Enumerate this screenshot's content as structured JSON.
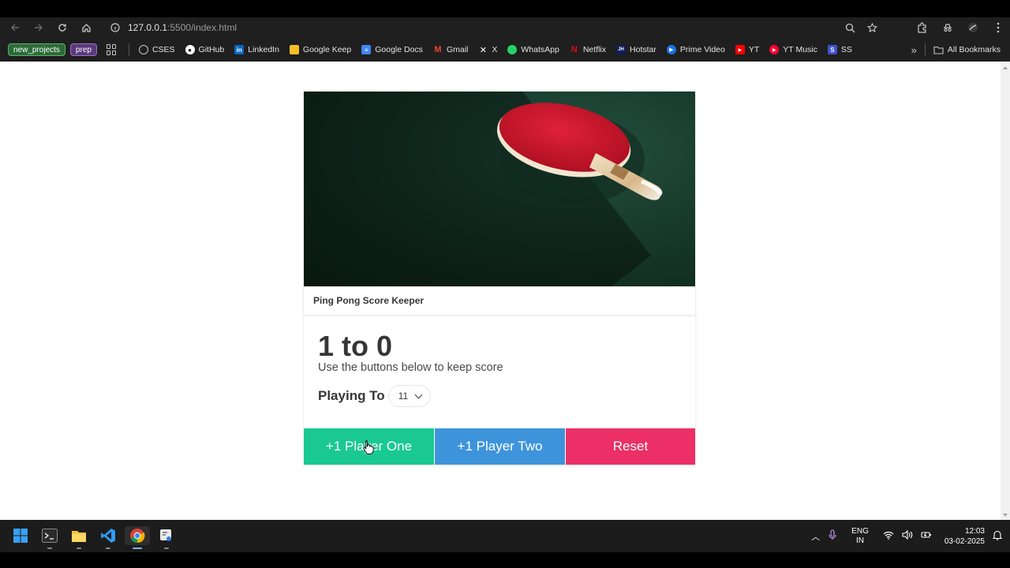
{
  "browser": {
    "url_host": "127.0.0.1",
    "url_rest": ":5500/index.html",
    "bookmarks": {
      "chip1": "new_projects",
      "chip2": "prep",
      "items": [
        "CSES",
        "GitHub",
        "LinkedIn",
        "Google Keep",
        "Google Docs",
        "Gmail",
        "X",
        "WhatsApp",
        "Netflix",
        "Hotstar",
        "Prime Video",
        "YT",
        "YT Music",
        "SS"
      ],
      "all_bookmarks": "All Bookmarks"
    }
  },
  "app": {
    "card_title": "Ping Pong Score Keeper",
    "score_p1": "1",
    "score_sep": "to",
    "score_p2": "0",
    "subtitle": "Use the buttons below to keep score",
    "playing_to_label": "Playing To",
    "playing_to_value": "11",
    "buttons": {
      "p1": "+1 Player One",
      "p2": "+1 Player Two",
      "reset": "Reset"
    }
  },
  "taskbar": {
    "lang_line1": "ENG",
    "lang_line2": "IN",
    "time": "12:03",
    "date": "03-02-2025"
  },
  "colors": {
    "player_one": "#1ac991",
    "player_two": "#3e94db",
    "reset": "#ec2f66"
  }
}
